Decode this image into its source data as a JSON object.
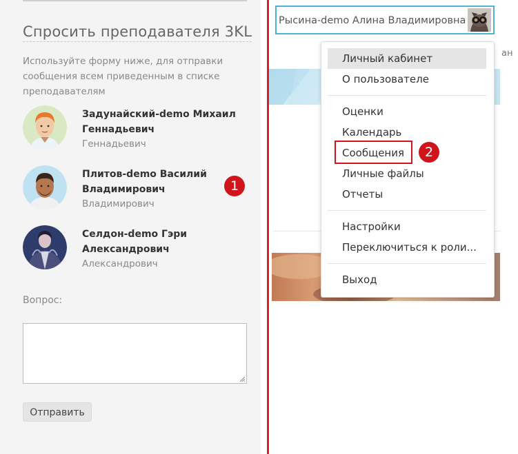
{
  "left_panel": {
    "title": "Спросить преподавателя 3KL",
    "description": "Используйте форму ниже, для отправки сообщения всем приведенным в списке преподавателям",
    "teachers": [
      {
        "name": "Задунайский-demo Михаил Геннадьевич",
        "subtitle": "Геннадьевич"
      },
      {
        "name": "Плитов-demo Василий Владимирович",
        "subtitle": "Владимирович"
      },
      {
        "name": "Селдон-demo Гэри Александрович",
        "subtitle": "Александрович"
      }
    ],
    "question_label": "Вопрос:",
    "question_value": "",
    "send_button": "Отправить"
  },
  "annotations": {
    "badge_1": "1",
    "badge_2": "2"
  },
  "right_panel": {
    "user_name": "Рысина-demo Алина Владимировна",
    "clipped_text": "ан",
    "menu": {
      "group1": [
        "Личный кабинет",
        "О пользователе"
      ],
      "group2": [
        "Оценки",
        "Календарь",
        "Сообщения",
        "Личные файлы",
        "Отчеты"
      ],
      "group3": [
        "Настройки",
        "Переключиться к роли..."
      ],
      "group4": [
        "Выход"
      ]
    }
  },
  "colors": {
    "accent_red": "#d0141c",
    "user_border": "#4cb3d4",
    "divider": "#d81e2a"
  },
  "icons": [
    "teacher-avatar-1",
    "teacher-avatar-2",
    "teacher-avatar-3",
    "user-avatar-icon",
    "resize-grip-icon"
  ]
}
